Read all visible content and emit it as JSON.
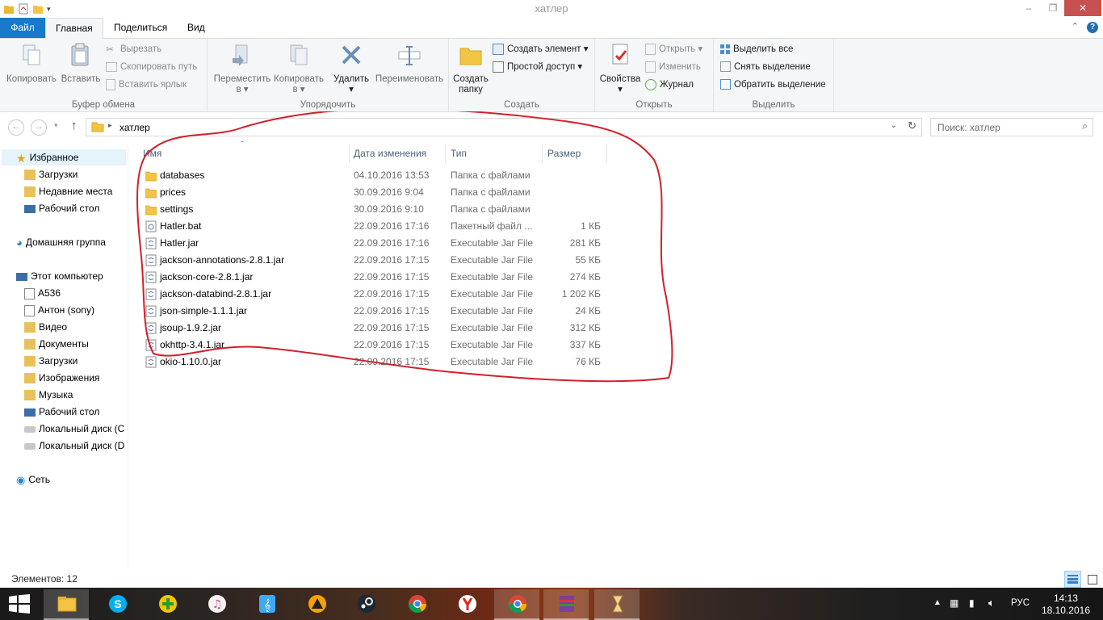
{
  "window": {
    "title": "хатлер"
  },
  "tabs": [
    {
      "label": "Файл"
    },
    {
      "label": "Главная"
    },
    {
      "label": "Поделиться"
    },
    {
      "label": "Вид"
    }
  ],
  "ribbon": {
    "clipboard": {
      "title": "Буфер обмена",
      "copy": "Копировать",
      "paste": "Вставить",
      "cut": "Вырезать",
      "copy_path": "Скопировать путь",
      "paste_shortcut": "Вставить ярлык"
    },
    "organize": {
      "title": "Упорядочить",
      "move_to": "Переместить",
      "move_to_sub": "в ▾",
      "copy_to": "Копировать",
      "copy_to_sub": "в ▾",
      "delete": "Удалить",
      "delete_sub": "▾",
      "rename": "Переименовать"
    },
    "new": {
      "title": "Создать",
      "new_folder": "Создать",
      "new_folder_2": "папку",
      "new_item": "Создать элемент ▾",
      "easy_access": "Простой доступ ▾"
    },
    "open": {
      "title": "Открыть",
      "properties": "Свойства",
      "properties_sub": "▾",
      "open": "Открыть ▾",
      "edit": "Изменить",
      "history": "Журнал"
    },
    "select": {
      "title": "Выделить",
      "select_all": "Выделить все",
      "select_none": "Снять выделение",
      "invert": "Обратить выделение"
    }
  },
  "address": {
    "path": "хатлер",
    "search_placeholder": "Поиск: хатлер"
  },
  "nav": {
    "favorites": "Избранное",
    "fav_items": [
      "Загрузки",
      "Недавние места",
      "Рабочий стол"
    ],
    "homegroup": "Домашняя группа",
    "computer": "Этот компьютер",
    "pc_items": [
      "A536",
      "Антон (sony)",
      "Видео",
      "Документы",
      "Загрузки",
      "Изображения",
      "Музыка",
      "Рабочий стол",
      "Локальный диск (C",
      "Локальный диск (D"
    ],
    "network": "Сеть"
  },
  "columns": {
    "name": "Имя",
    "date": "Дата изменения",
    "type": "Тип",
    "size": "Размер"
  },
  "files": [
    {
      "name": "databases",
      "date": "04.10.2016 13:53",
      "type": "Папка с файлами",
      "size": "",
      "kind": "folder"
    },
    {
      "name": "prices",
      "date": "30.09.2016 9:04",
      "type": "Папка с файлами",
      "size": "",
      "kind": "folder"
    },
    {
      "name": "settings",
      "date": "30.09.2016 9:10",
      "type": "Папка с файлами",
      "size": "",
      "kind": "folder"
    },
    {
      "name": "Hatler.bat",
      "date": "22.09.2016 17:16",
      "type": "Пакетный файл ...",
      "size": "1 КБ",
      "kind": "bat"
    },
    {
      "name": "Hatler.jar",
      "date": "22.09.2016 17:16",
      "type": "Executable Jar File",
      "size": "281 КБ",
      "kind": "jar"
    },
    {
      "name": "jackson-annotations-2.8.1.jar",
      "date": "22.09.2016 17:15",
      "type": "Executable Jar File",
      "size": "55 КБ",
      "kind": "jar"
    },
    {
      "name": "jackson-core-2.8.1.jar",
      "date": "22.09.2016 17:15",
      "type": "Executable Jar File",
      "size": "274 КБ",
      "kind": "jar"
    },
    {
      "name": "jackson-databind-2.8.1.jar",
      "date": "22.09.2016 17:15",
      "type": "Executable Jar File",
      "size": "1 202 КБ",
      "kind": "jar"
    },
    {
      "name": "json-simple-1.1.1.jar",
      "date": "22.09.2016 17:15",
      "type": "Executable Jar File",
      "size": "24 КБ",
      "kind": "jar"
    },
    {
      "name": "jsoup-1.9.2.jar",
      "date": "22.09.2016 17:15",
      "type": "Executable Jar File",
      "size": "312 КБ",
      "kind": "jar"
    },
    {
      "name": "okhttp-3.4.1.jar",
      "date": "22.09.2016 17:15",
      "type": "Executable Jar File",
      "size": "337 КБ",
      "kind": "jar"
    },
    {
      "name": "okio-1.10.0.jar",
      "date": "22.09.2016 17:15",
      "type": "Executable Jar File",
      "size": "76 КБ",
      "kind": "jar"
    }
  ],
  "status": {
    "count": "Элементов: 12"
  },
  "taskbar": {
    "apps": [
      "file-explorer",
      "skype",
      "plus-app",
      "itunes",
      "music-app",
      "aimp",
      "steam",
      "chrome",
      "yandex-browser",
      "chrome",
      "winrar",
      "hourglass-app"
    ],
    "lang": "РУС",
    "time": "14:13",
    "date": "18.10.2016"
  },
  "colors": {
    "accent": "#1979ca",
    "annotation": "#d2202a",
    "folder": "#f3c443"
  }
}
